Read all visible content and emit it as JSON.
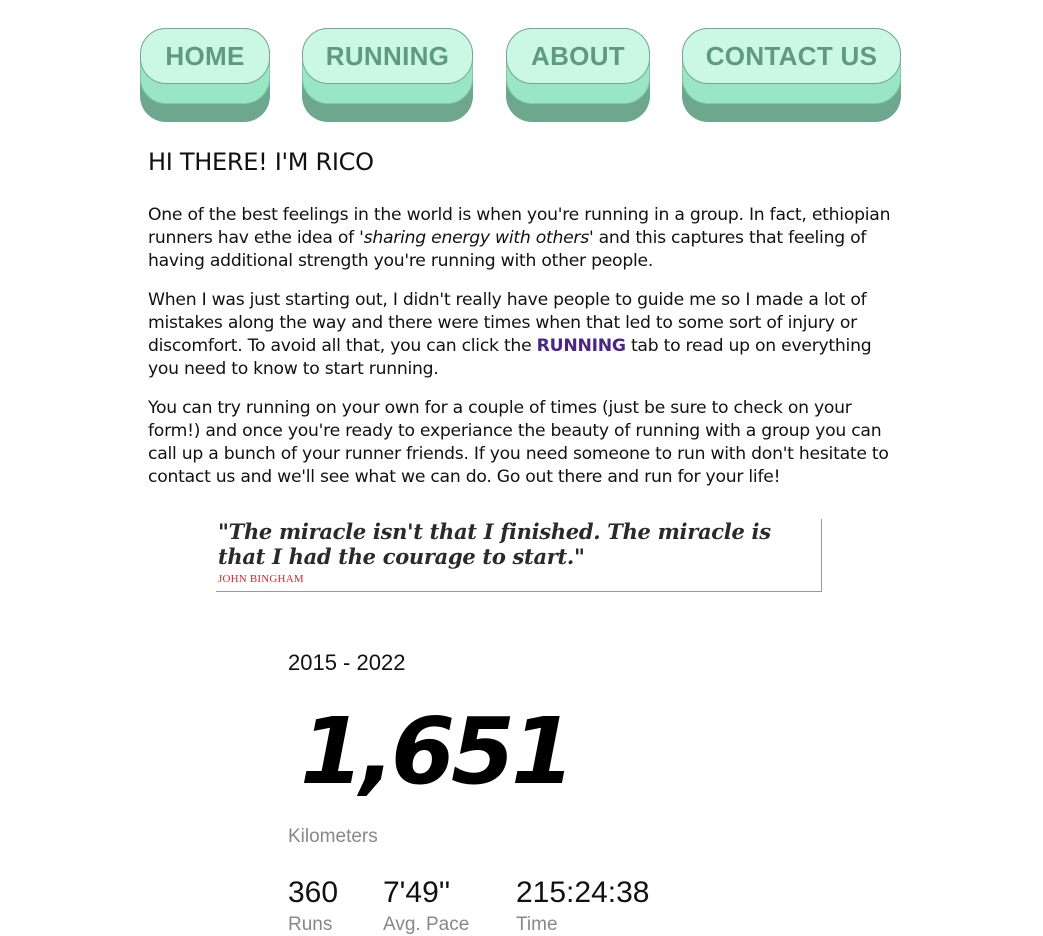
{
  "nav": {
    "items": [
      {
        "label": "HOME"
      },
      {
        "label": "RUNNING"
      },
      {
        "label": "ABOUT"
      },
      {
        "label": "CONTACT US"
      }
    ]
  },
  "intro": {
    "title": "HI THERE! I'M RICO",
    "p1_a": "One of the best feelings in the world is when you're running in a group. In fact, ethiopian runners hav ethe idea of ",
    "p1_em": "'sharing energy with others'",
    "p1_b": " and this captures that feeling of having additional strength you're running with other people.",
    "p2_a": "When I was just starting out, I didn't really have people to guide me so I made a lot of mistakes along the way and there were times when that led to some sort of injury or discomfort. To avoid all that, you can click the ",
    "p2_link": "RUNNING",
    "p2_b": " tab to read up on everything you need to know to start running.",
    "p3": "You can try running on your own for a couple of times (just be sure to check on your form!) and once you're ready to experiance the beauty of running with a group you can call up a bunch of your runner friends. If you need someone to run with don't hesitate to contact us and we'll see what we can do. Go out there and run for your life!"
  },
  "quote": {
    "text": "\"The miracle isn't that I finished. The miracle is that I had the courage to start.\"",
    "author": "JOHN BINGHAM"
  },
  "stats": {
    "years": "2015 - 2022",
    "distance": "1,651",
    "distance_unit": "Kilometers",
    "runs": "360",
    "runs_label": "Runs",
    "pace": "7'49''",
    "pace_label": "Avg. Pace",
    "time": "215:24:38",
    "time_label": "Time"
  }
}
